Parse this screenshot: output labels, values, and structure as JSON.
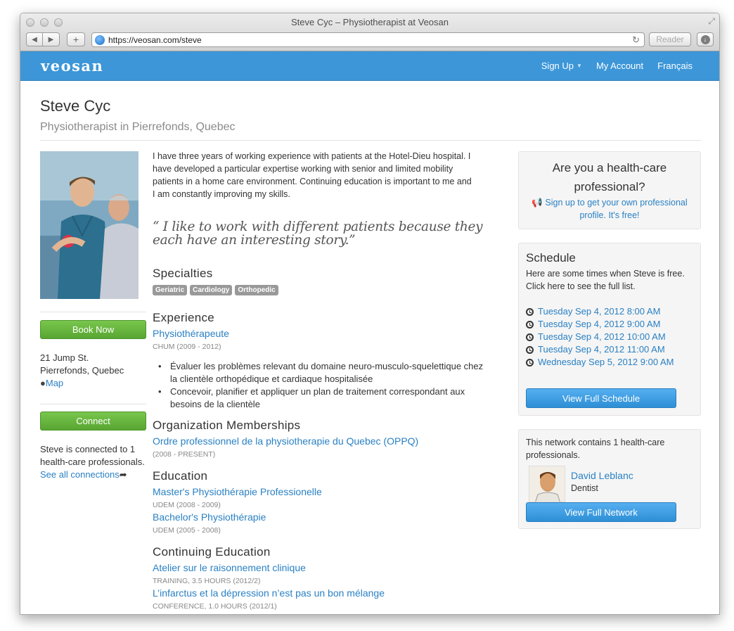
{
  "window": {
    "title": "Steve Cyc – Physiotherapist at Veosan",
    "url": "https://veosan.com/steve",
    "reader_label": "Reader"
  },
  "nav": {
    "logo": "veosan",
    "items": [
      {
        "label": "Sign Up"
      },
      {
        "label": "My Account"
      },
      {
        "label": "Français"
      }
    ]
  },
  "profile": {
    "name": "Steve Cyc",
    "subtitle": "Physiotherapist in Pierrefonds, Quebec",
    "bio": "I have three years of working experience with patients at the Hotel-Dieu hospital. I have developed a particular expertise working with senior and limited mobility patients in a home care environment. Continuing education is important to me and I am constantly improving my skills.",
    "quote": "“ I like to work with different patients because they each have an interesting story.”"
  },
  "sidebar": {
    "book_label": "Book Now",
    "address_line1": "21 Jump St.",
    "address_line2": "Pierrefonds, Quebec",
    "map_label": "Map",
    "connect_label": "Connect",
    "connections_text": "Steve is connected to 1 health-care professionals.",
    "see_all_label": "See all connections"
  },
  "specialties": {
    "heading": "Specialties",
    "badges": [
      "Geriatric",
      "Cardiology",
      "Orthopedic"
    ]
  },
  "experience": {
    "heading": "Experience",
    "title": "Physiothérapeute",
    "meta": "CHUM (2009 - 2012)",
    "bullets": [
      "Évaluer les problèmes relevant du domaine neuro-musculo-squelettique chez la clientèle orthopédique et cardiaque hospitalisée",
      "Concevoir, planifier et appliquer un plan de traitement correspondant aux besoins de la clientèle"
    ]
  },
  "memberships": {
    "heading": "Organization Memberships",
    "title": "Ordre professionnel de la physiotherapie du Quebec (OPPQ)",
    "meta": "(2008 - PRESENT)"
  },
  "education": {
    "heading": "Education",
    "items": [
      {
        "title": "Master's Physiothérapie Professionelle",
        "meta": "UDEM (2008 - 2009)"
      },
      {
        "title": "Bachelor's Physiothérapie",
        "meta": "UDEM (2005 - 2008)"
      }
    ]
  },
  "continuing": {
    "heading": "Continuing Education",
    "items": [
      {
        "title": "Atelier sur le raisonnement clinique",
        "meta": "TRAINING, 3.5 HOURS (2012/2)"
      },
      {
        "title": "L’infarctus et la dépression n’est pas un bon mélange",
        "meta": "CONFERENCE, 1.0 HOURS (2012/1)"
      }
    ]
  },
  "promo": {
    "title": "Are you a health-care professional?",
    "link": "Sign up to get your own professional profile. It's free!"
  },
  "schedule": {
    "title": "Schedule",
    "intro": "Here are some times when Steve is free.",
    "full_list_link": "Click here to see the full list.",
    "slots": [
      "Tuesday Sep 4, 2012 8:00 AM",
      "Tuesday Sep 4, 2012 9:00 AM",
      "Tuesday Sep 4, 2012 10:00 AM",
      "Tuesday Sep 4, 2012 11:00 AM",
      "Wednesday Sep 5, 2012 9:00 AM"
    ],
    "button": "View Full Schedule"
  },
  "network": {
    "intro": "This network contains 1 health-care professionals.",
    "contact_name": "David Leblanc",
    "contact_role": "Dentist",
    "button": "View Full Network"
  }
}
